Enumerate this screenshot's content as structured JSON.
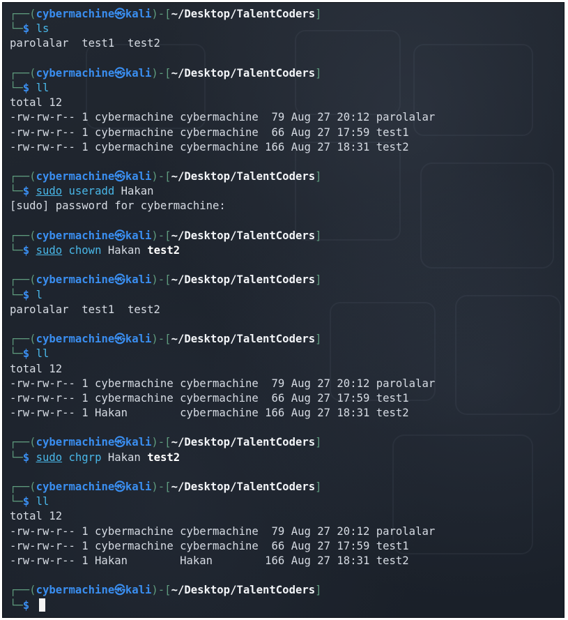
{
  "prompt": {
    "open": "┌──(",
    "user": "cybermachine",
    "skull": "㉿",
    "host": "kali",
    "sep": ")-[",
    "path": "~/Desktop/TalentCoders",
    "close": "]",
    "corner": "└─",
    "dollar": "$"
  },
  "blocks": [
    {
      "cmd": "ls",
      "output": [
        "parolalar  test1  test2"
      ]
    },
    {
      "cmd": "ll",
      "output": [
        "total 12",
        "-rw-rw-r-- 1 cybermachine cybermachine  79 Aug 27 20:12 parolalar",
        "-rw-rw-r-- 1 cybermachine cybermachine  66 Aug 27 17:59 test1",
        "-rw-rw-r-- 1 cybermachine cybermachine 166 Aug 27 18:31 test2"
      ]
    },
    {
      "sudo": "sudo",
      "cmd": "useradd",
      "args": "Hakan",
      "output": [
        "[sudo] password for cybermachine:"
      ]
    },
    {
      "sudo": "sudo",
      "cmd": "chown",
      "args": "Hakan",
      "arg_bold": "test2",
      "output": []
    },
    {
      "cmd": "l",
      "output": [
        "parolalar  test1  test2"
      ]
    },
    {
      "cmd": "ll",
      "output": [
        "total 12",
        "-rw-rw-r-- 1 cybermachine cybermachine  79 Aug 27 20:12 parolalar",
        "-rw-rw-r-- 1 cybermachine cybermachine  66 Aug 27 17:59 test1",
        "-rw-rw-r-- 1 Hakan        cybermachine 166 Aug 27 18:31 test2"
      ]
    },
    {
      "sudo": "sudo",
      "cmd": "chgrp",
      "args": "Hakan",
      "arg_bold": "test2",
      "output": []
    },
    {
      "cmd": "ll",
      "output": [
        "total 12",
        "-rw-rw-r-- 1 cybermachine cybermachine  79 Aug 27 20:12 parolalar",
        "-rw-rw-r-- 1 cybermachine cybermachine  66 Aug 27 17:59 test1",
        "-rw-rw-r-- 1 Hakan        Hakan        166 Aug 27 18:31 test2"
      ]
    },
    {
      "cmd": "",
      "output": [],
      "active": true
    }
  ]
}
